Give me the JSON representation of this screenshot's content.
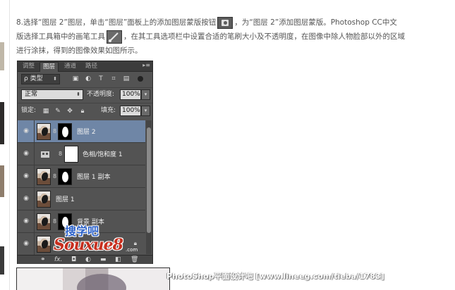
{
  "article": {
    "line1_a": "8.选择“图层 2”图层，单击“图层”面板上的添加图层蒙版按钮",
    "line1_b": "，为“图层 2”添加图层蒙版。Photoshop CC中文",
    "line2_a": "版选择工具箱中的画笔工具",
    "line2_b": "，在其工具选项栏中设置合适的笔刷大小及不透明度，在图像中除人物脸部以外的区域",
    "line3": "进行涂抹，得到的图像效果如图所示。"
  },
  "panel": {
    "tabs": [
      "调整",
      "图层",
      "通道",
      "路径"
    ],
    "active_tab": "图层",
    "filter_label": "ρ 类型",
    "blend_mode": "正常",
    "opacity_label": "不透明度:",
    "opacity_value": "100%",
    "lock_label": "锁定:",
    "fill_label": "填充:",
    "fill_value": "100%",
    "layers": [
      {
        "name": "图层 2",
        "selected": true
      },
      {
        "name": "色相/饱和度 1",
        "selected": false
      },
      {
        "name": "图层 1 副本",
        "selected": false
      },
      {
        "name": "图层 1",
        "selected": false
      },
      {
        "name": "背景 副本",
        "selected": false
      },
      {
        "name": "",
        "selected": false
      }
    ],
    "bottom_icons": [
      "link-icon",
      "fx-icon",
      "mask-icon",
      "adjustment-icon",
      "folder-icon",
      "new-layer-icon",
      "trash-icon"
    ]
  },
  "watermark": {
    "cn": "搜学吧",
    "en": "Souxue8",
    "com": ".com",
    "footer": "PhotoShop平面设计吧 [www.lineeg.com/tieba/1783]"
  }
}
